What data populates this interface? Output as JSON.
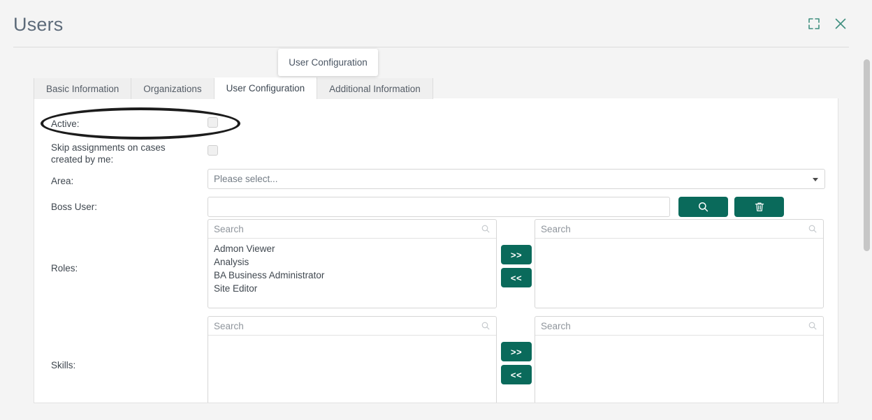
{
  "header": {
    "title": "Users",
    "expand_icon": "expand-icon",
    "close_icon": "close-icon"
  },
  "tooltip": {
    "text": "User Configuration"
  },
  "tabs": [
    {
      "label": "Basic Information",
      "active": false
    },
    {
      "label": "Organizations",
      "active": false
    },
    {
      "label": "User Configuration",
      "active": true
    },
    {
      "label": "Additional Information",
      "active": false
    }
  ],
  "form": {
    "active": {
      "label": "Active:",
      "checked": false
    },
    "skip_assignments": {
      "label": "Skip assignments on cases created by me:",
      "checked": false
    },
    "area": {
      "label": "Area:",
      "value": "Please select...",
      "caret_icon": "chevron-down-icon"
    },
    "boss_user": {
      "label": "Boss User:",
      "value": "",
      "placeholder": "",
      "search_button_icon": "search-icon",
      "delete_button_icon": "trash-icon"
    },
    "roles": {
      "label": "Roles:",
      "available_search_placeholder": "Search",
      "available_items": [
        "Admon Viewer",
        "Analysis",
        "BA Business Administrator",
        "Site Editor"
      ],
      "selected_search_placeholder": "Search",
      "selected_items": [],
      "add_button_label": ">>",
      "remove_button_label": "<<",
      "search_icon": "search-icon"
    },
    "skills": {
      "label": "Skills:",
      "available_search_placeholder": "Search",
      "available_items": [],
      "selected_search_placeholder": "Search",
      "selected_items": [],
      "add_button_label": ">>",
      "remove_button_label": "<<",
      "search_icon": "search-icon"
    }
  },
  "annotation": {
    "name": "highlight-ellipse-active-row"
  },
  "colors": {
    "accent_teal": "#0a6a5b",
    "title_gray": "#5d6b7a",
    "page_bg": "#f4f4f4",
    "icon_teal": "#3f8f7f"
  }
}
